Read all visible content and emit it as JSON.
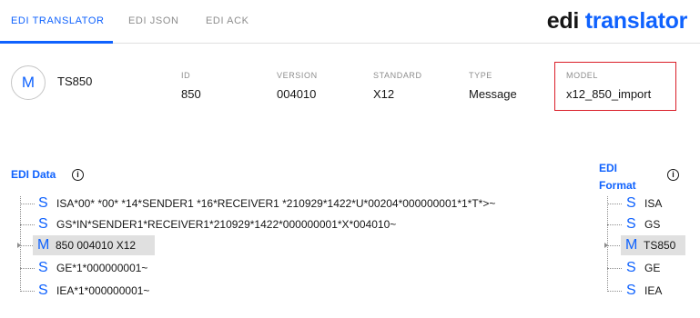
{
  "tabs": [
    {
      "label": "EDI TRANSLATOR",
      "active": true
    },
    {
      "label": "EDI JSON",
      "active": false
    },
    {
      "label": "EDI ACK",
      "active": false
    }
  ],
  "brand": {
    "part1": "edi",
    "part2": "translator"
  },
  "header": {
    "avatar_letter": "M",
    "name": "TS850",
    "fields": [
      {
        "label": "ID",
        "value": "850"
      },
      {
        "label": "VERSION",
        "value": "004010"
      },
      {
        "label": "STANDARD",
        "value": "X12"
      },
      {
        "label": "TYPE",
        "value": "Message"
      }
    ],
    "model": {
      "label": "MODEL",
      "value": "x12_850_import"
    }
  },
  "edi_data": {
    "title": "EDI Data",
    "info_icon": "i",
    "nodes": [
      {
        "symbol": "S",
        "text": "ISA*00* *00* *14*SENDER1 *16*RECEIVER1 *210929*1422*U*00204*000000001*1*T*>~"
      },
      {
        "symbol": "S",
        "text": "GS*IN*SENDER1*RECEIVER1*210929*1422*000000001*X*004010~"
      },
      {
        "symbol": "M",
        "text": "850 004010 X12"
      },
      {
        "symbol": "S",
        "text": "GE*1*000000001~"
      },
      {
        "symbol": "S",
        "text": "IEA*1*000000001~"
      }
    ]
  },
  "edi_format": {
    "title_line1": "EDI",
    "title_line2": "Format",
    "info_icon": "i",
    "nodes": [
      {
        "symbol": "S",
        "text": "ISA"
      },
      {
        "symbol": "S",
        "text": "GS"
      },
      {
        "symbol": "M",
        "text": "TS850"
      },
      {
        "symbol": "S",
        "text": "GE"
      },
      {
        "symbol": "S",
        "text": "IEA"
      }
    ]
  },
  "colors": {
    "accent": "#0f62fe",
    "highlight": "#da1e28",
    "selected_bg": "#e0e0e0"
  }
}
